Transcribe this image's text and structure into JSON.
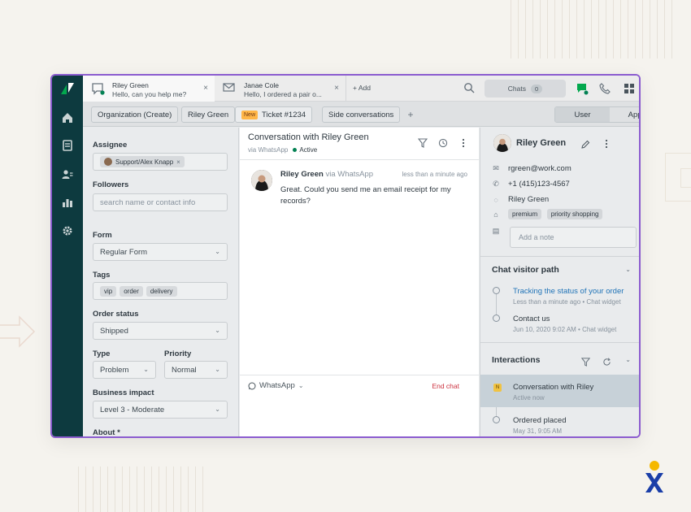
{
  "colors": {
    "frame_border": "#8b5ccf",
    "rail": "#0d3a3f",
    "link": "#1f73b7",
    "danger": "#cc3340",
    "active_green": "#038153",
    "new_badge": "#ffb648"
  },
  "tabs": [
    {
      "name": "Riley Green",
      "preview": "Hello, can you help me?",
      "icon": "chat-bubble-icon",
      "close": "×"
    },
    {
      "name": "Janae Cole",
      "preview": "Hello, I ordered a pair o...",
      "icon": "mail-icon",
      "close": "×"
    }
  ],
  "topbar": {
    "add_label": "+ Add",
    "chats_label": "Chats",
    "chats_count": "0"
  },
  "context_bar": {
    "org": "Organization (Create)",
    "user": "Riley Green",
    "new_badge": "New",
    "ticket": "Ticket #1234",
    "side": "Side conversations",
    "plus": "+",
    "seg_user": "User",
    "seg_apps": "Apps"
  },
  "props": {
    "assignee_label": "Assignee",
    "assignee_value": "Support/Alex Knapp",
    "followers_label": "Followers",
    "followers_placeholder": "search name or contact info",
    "form_label": "Form",
    "form_value": "Regular Form",
    "tags_label": "Tags",
    "tags": [
      "vip",
      "order",
      "delivery"
    ],
    "order_status_label": "Order status",
    "order_status_value": "Shipped",
    "type_label": "Type",
    "type_value": "Problem",
    "priority_label": "Priority",
    "priority_value": "Normal",
    "impact_label": "Business impact",
    "impact_value": "Level 3 - Moderate",
    "about_label": "About *"
  },
  "conversation": {
    "title": "Conversation with Riley Green",
    "via": "via WhatsApp",
    "status": "Active",
    "message": {
      "author": "Riley Green",
      "via": "via WhatsApp",
      "time": "less than a minute ago",
      "text": "Great. Could you send me an email receipt for my records?"
    },
    "channel": "WhatsApp",
    "end_chat": "End chat"
  },
  "user_panel": {
    "name": "Riley Green",
    "email": "rgreen@work.com",
    "phone": "+1 (415)123-4567",
    "whatsapp": "Riley Green",
    "tags": [
      "premium",
      "priority shopping"
    ],
    "note_placeholder": "Add a note"
  },
  "visitor_path": {
    "title": "Chat visitor path",
    "items": [
      {
        "title": "Tracking the status of your order",
        "sub": "Less than a minute ago • Chat widget"
      },
      {
        "title": "Contact us",
        "sub": "Jun 10, 2020 9:02 AM • Chat widget"
      }
    ]
  },
  "interactions": {
    "title": "Interactions",
    "items": [
      {
        "title": "Conversation with Riley",
        "sub": "Active now",
        "badge": "N"
      },
      {
        "title": "Ordered placed",
        "sub": "May 31, 9:05 AM"
      }
    ]
  }
}
